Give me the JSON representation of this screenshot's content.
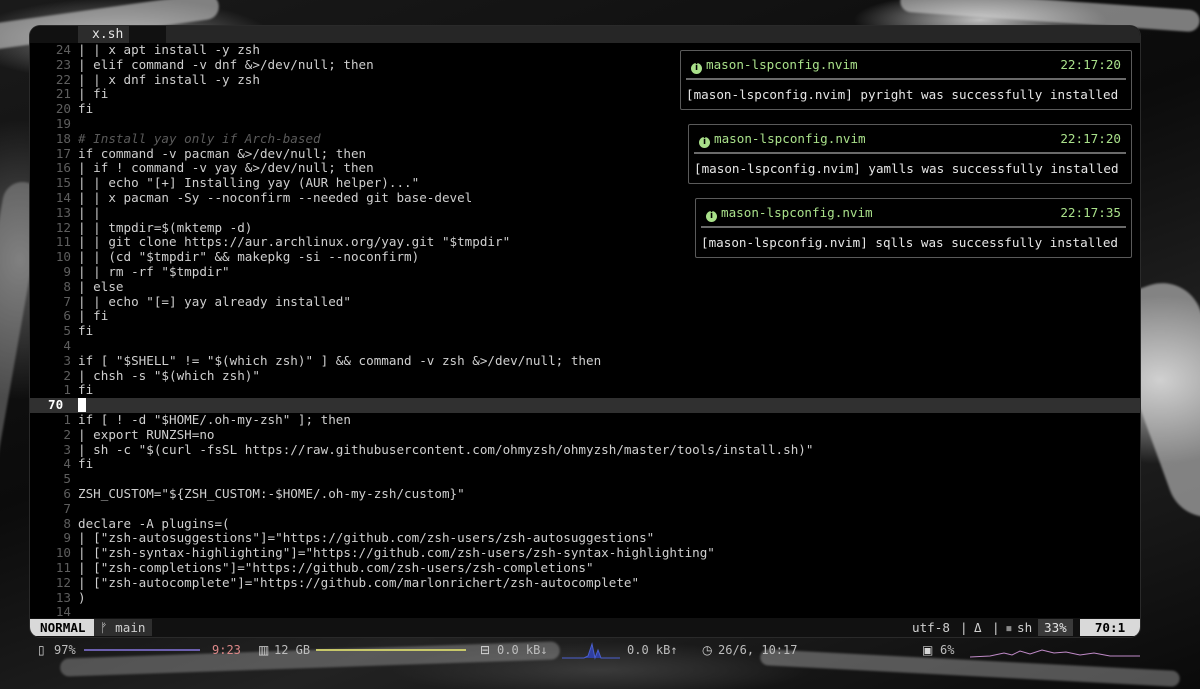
{
  "tab": {
    "title": "x.sh"
  },
  "editor": {
    "lines": [
      {
        "n": "24",
        "t": "| | x apt install -y zsh"
      },
      {
        "n": "23",
        "t": "| elif command -v dnf &>/dev/null; then"
      },
      {
        "n": "22",
        "t": "| | x dnf install -y zsh"
      },
      {
        "n": "21",
        "t": "| fi"
      },
      {
        "n": "20",
        "t": "fi"
      },
      {
        "n": "19",
        "t": ""
      },
      {
        "n": "18",
        "t": "# Install yay only if Arch-based",
        "c": true
      },
      {
        "n": "17",
        "t": "if command -v pacman &>/dev/null; then"
      },
      {
        "n": "16",
        "t": "| if ! command -v yay &>/dev/null; then"
      },
      {
        "n": "15",
        "t": "| | echo \"[+] Installing yay (AUR helper)...\""
      },
      {
        "n": "14",
        "t": "| | x pacman -Sy --noconfirm --needed git base-devel"
      },
      {
        "n": "13",
        "t": "| |"
      },
      {
        "n": "12",
        "t": "| | tmpdir=$(mktemp -d)"
      },
      {
        "n": "11",
        "t": "| | git clone https://aur.archlinux.org/yay.git \"$tmpdir\""
      },
      {
        "n": "10",
        "t": "| | (cd \"$tmpdir\" && makepkg -si --noconfirm)"
      },
      {
        "n": "9",
        "t": "| | rm -rf \"$tmpdir\""
      },
      {
        "n": "8",
        "t": "| else"
      },
      {
        "n": "7",
        "t": "| | echo \"[=] yay already installed\""
      },
      {
        "n": "6",
        "t": "| fi"
      },
      {
        "n": "5",
        "t": "fi"
      },
      {
        "n": "4",
        "t": ""
      },
      {
        "n": "3",
        "t": "if [ \"$SHELL\" != \"$(which zsh)\" ] && command -v zsh &>/dev/null; then"
      },
      {
        "n": "2",
        "t": "| chsh -s \"$(which zsh)\""
      },
      {
        "n": "1",
        "t": "fi"
      },
      {
        "n": "70",
        "t": "",
        "cur": true
      },
      {
        "n": "1",
        "t": "if [ ! -d \"$HOME/.oh-my-zsh\" ]; then"
      },
      {
        "n": "2",
        "t": "| export RUNZSH=no"
      },
      {
        "n": "3",
        "t": "| sh -c \"$(curl -fsSL https://raw.githubusercontent.com/ohmyzsh/ohmyzsh/master/tools/install.sh)\""
      },
      {
        "n": "4",
        "t": "fi"
      },
      {
        "n": "5",
        "t": ""
      },
      {
        "n": "6",
        "t": "ZSH_CUSTOM=\"${ZSH_CUSTOM:-$HOME/.oh-my-zsh/custom}\""
      },
      {
        "n": "7",
        "t": ""
      },
      {
        "n": "8",
        "t": "declare -A plugins=("
      },
      {
        "n": "9",
        "t": "| [\"zsh-autosuggestions\"]=\"https://github.com/zsh-users/zsh-autosuggestions\""
      },
      {
        "n": "10",
        "t": "| [\"zsh-syntax-highlighting\"]=\"https://github.com/zsh-users/zsh-syntax-highlighting\""
      },
      {
        "n": "11",
        "t": "| [\"zsh-completions\"]=\"https://github.com/zsh-users/zsh-completions\""
      },
      {
        "n": "12",
        "t": "| [\"zsh-autocomplete\"]=\"https://github.com/marlonrichert/zsh-autocomplete\""
      },
      {
        "n": "13",
        "t": ")"
      },
      {
        "n": "14",
        "t": ""
      }
    ]
  },
  "notifications": [
    {
      "title": "mason-lspconfig.nvim",
      "time": "22:17:20",
      "message": "[mason-lspconfig.nvim] pyright was successfully installed"
    },
    {
      "title": "mason-lspconfig.nvim",
      "time": "22:17:20",
      "message": "[mason-lspconfig.nvim] yamlls was successfully installed"
    },
    {
      "title": "mason-lspconfig.nvim",
      "time": "22:17:35",
      "message": "[mason-lspconfig.nvim] sqlls was successfully installed"
    }
  ],
  "statusline": {
    "mode": "NORMAL",
    "branch_icon": "ᚠ",
    "branch": "main",
    "encoding": "utf-8",
    "sep": "|",
    "os_icon": "Δ",
    "ft_icon": "▪",
    "filetype": "sh",
    "percent": "33%",
    "position": "70:1"
  },
  "systembar": {
    "battery_icon": "▯",
    "battery": "97%",
    "battery_fill": 0.97,
    "battery_time": "9:23",
    "memory_icon": "▥",
    "memory": "12 GB",
    "net_icon": "⊟",
    "net_down": "0.0 kB↓",
    "net_up": "0.0 kB↑",
    "clock_icon": "◷",
    "datetime": "26/6, 10:17",
    "cpu_icon": "▣",
    "cpu": "6%"
  },
  "colors": {
    "accent_green": "#a9e08a",
    "mode_bg": "#d9d9d9"
  }
}
